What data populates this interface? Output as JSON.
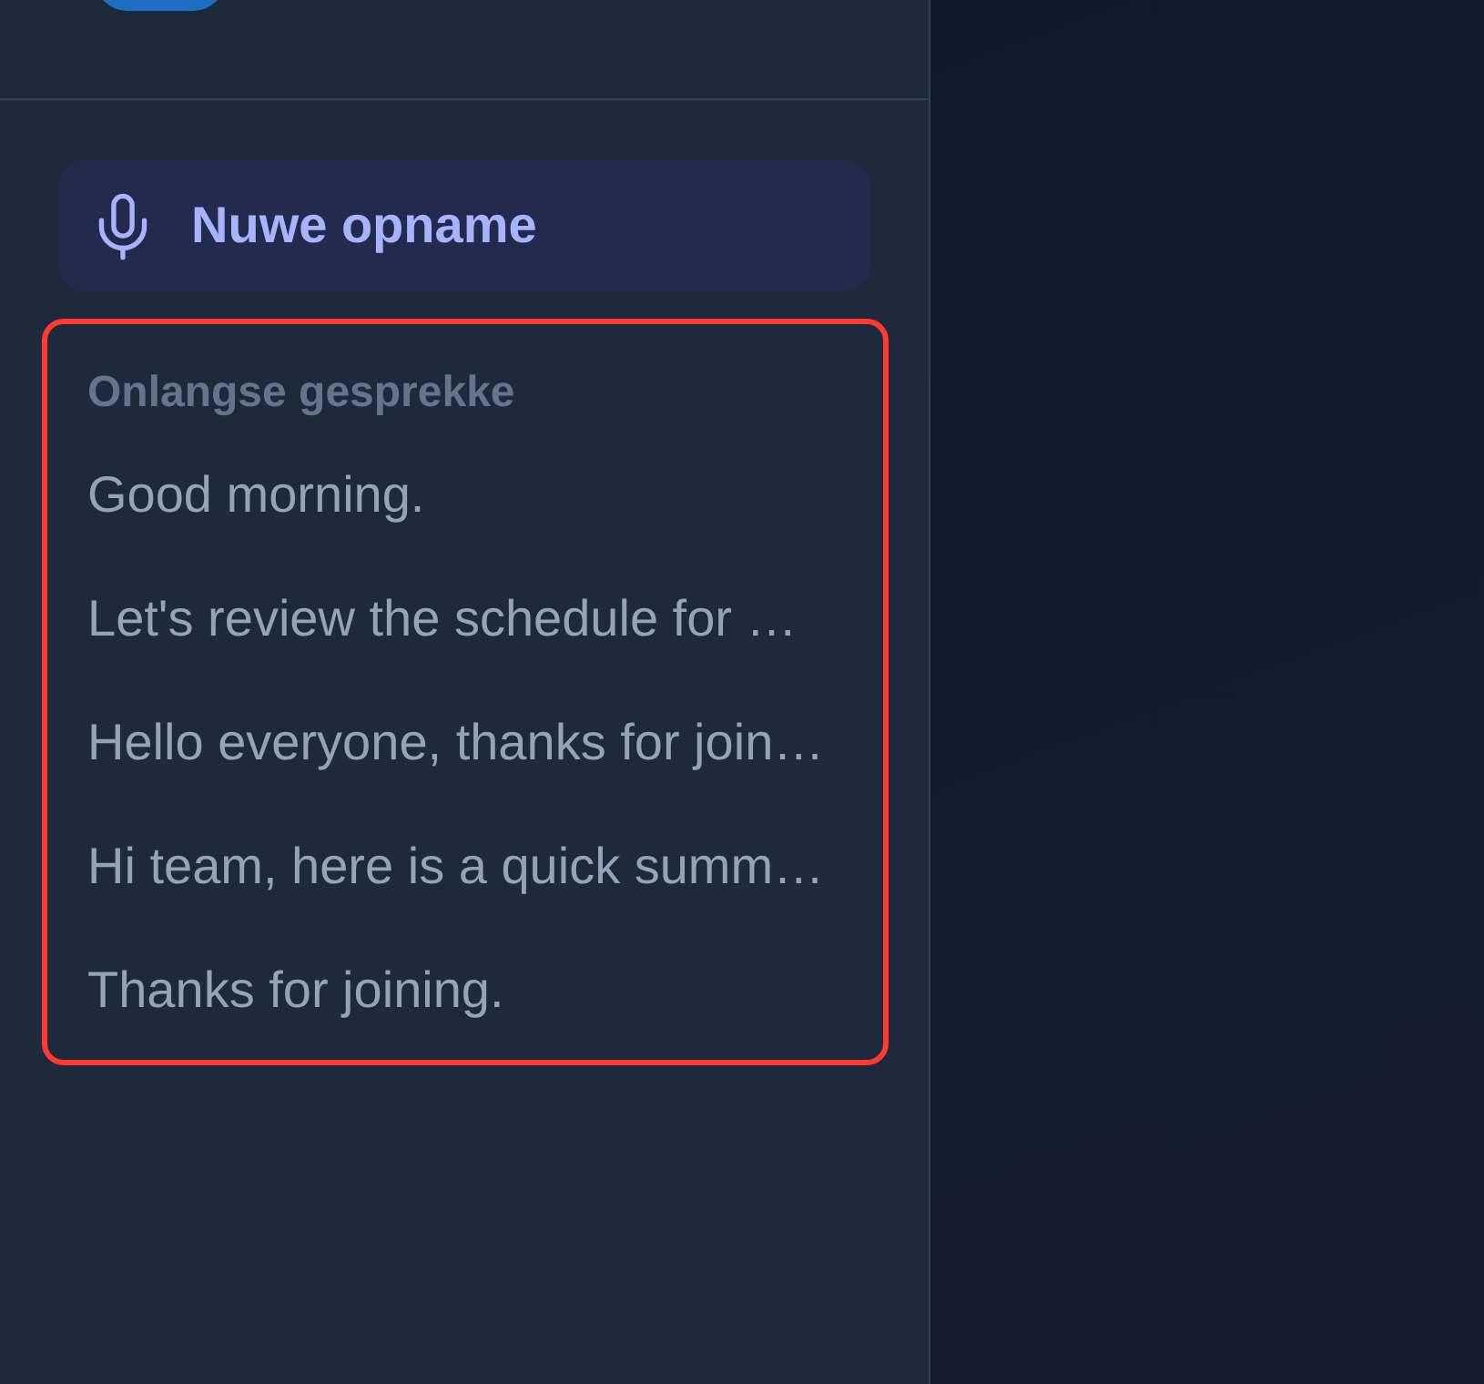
{
  "sidebar": {
    "new_recording_button": {
      "label": "Nuwe opname"
    },
    "recent": {
      "highlighted": true,
      "title": "Onlangse gesprekke",
      "items": [
        "Good morning.",
        "Let's review the schedule for …",
        "Hello everyone, thanks for join…",
        "Hi team, here is a quick summ…",
        "Thanks for joining."
      ]
    }
  }
}
